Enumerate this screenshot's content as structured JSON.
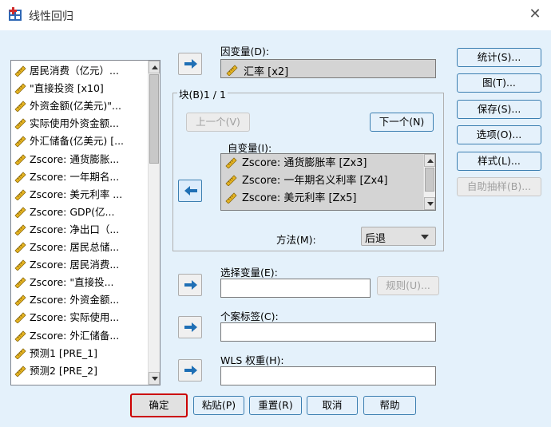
{
  "window": {
    "title": "线性回归",
    "close_glyph": "✕"
  },
  "source_list": {
    "items": [
      "居民消费（亿元）...",
      "\"直接投资 [x10]",
      "外资金额(亿美元)\"...",
      "实际使用外资金额...",
      "外汇储备(亿美元) [...",
      "Zscore: 通货膨胀...",
      "Zscore: 一年期名...",
      "Zscore: 美元利率 ...",
      "Zscore: GDP(亿...",
      "Zscore: 净出口（...",
      "Zscore: 居民总储...",
      "Zscore: 居民消费...",
      "Zscore: \"直接投...",
      "Zscore: 外资金额...",
      "Zscore: 实际使用...",
      "Zscore: 外汇储备...",
      "预测1 [PRE_1]",
      "预测2 [PRE_2]"
    ]
  },
  "dependent": {
    "label": "因变量(D):",
    "value": "汇率 [x2]"
  },
  "block": {
    "label": "块(B)1 / 1",
    "prev_label": "上一个(V)",
    "next_label": "下一个(N)",
    "independents_label": "自变量(I):",
    "independents": [
      "Zscore: 通货膨胀率 [Zx3]",
      "Zscore: 一年期名义利率 [Zx4]",
      "Zscore: 美元利率 [Zx5]"
    ],
    "method_label": "方法(M):",
    "method_value": "后退"
  },
  "selection": {
    "label": "选择变量(E):",
    "value": "",
    "rule_label": "规则(U)..."
  },
  "case_label": {
    "label": "个案标签(C):",
    "value": ""
  },
  "wls": {
    "label": "WLS 权重(H):",
    "value": ""
  },
  "side_buttons": {
    "statistics": "统计(S)...",
    "plots": "图(T)...",
    "save": "保存(S)...",
    "options": "选项(O)...",
    "style": "样式(L)...",
    "bootstrap": "自助抽样(B)..."
  },
  "bottom_buttons": {
    "ok": "确定",
    "paste": "粘贴(P)",
    "reset": "重置(R)",
    "cancel": "取消",
    "help": "帮助"
  },
  "colors": {
    "background": "#e4f1fb",
    "default_outline": "#cc0000",
    "arrow_icon": "#1f6fb5"
  }
}
